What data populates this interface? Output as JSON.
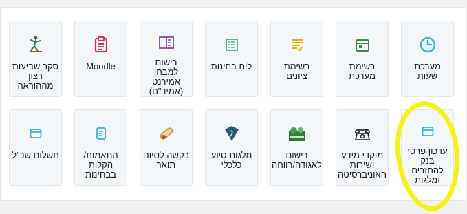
{
  "accent_color": "#3ab0e0",
  "highlight_color": "#f5f01a",
  "tiles_row1": [
    {
      "label": "מערכת\nשעות",
      "icon": "clock-icon"
    },
    {
      "label": "רשימת\nמערכת",
      "icon": "calendar-icon"
    },
    {
      "label": "רשימת\nציונים",
      "icon": "grades-list-icon"
    },
    {
      "label": "לוח בחינות",
      "icon": "exam-board-icon"
    },
    {
      "label": "רישום\nלמבחן\nאמירנט\n(אמיר\"ם)",
      "icon": "book-open-icon"
    },
    {
      "label": "Moodle",
      "icon": "clipboard-icon"
    },
    {
      "label": "סקר שביעות\nרצון\nמההוראה",
      "icon": "survey-figure-icon"
    }
  ],
  "tiles_row2": [
    {
      "label": "עדכון פרטי\nבנק\nלהחזרים\nומלגות",
      "icon": "card-icon"
    },
    {
      "label": "מוקדי מידע\nושירות\nהאוניברסיטה",
      "icon": "telephone-icon"
    },
    {
      "label": "רישום\nלאגודה/רווחה",
      "icon": "student-union-icon"
    },
    {
      "label": "מלגות סיוע\nכלכלי",
      "icon": "scholarship-icon"
    },
    {
      "label": "בקשה לסיום\nתואר",
      "icon": "diploma-scroll-icon"
    },
    {
      "label": "התאמות/\nהקלות\nבבחינות",
      "icon": "document-icon"
    },
    {
      "label": "תשלום שכ\"ל",
      "icon": "card-icon"
    }
  ]
}
